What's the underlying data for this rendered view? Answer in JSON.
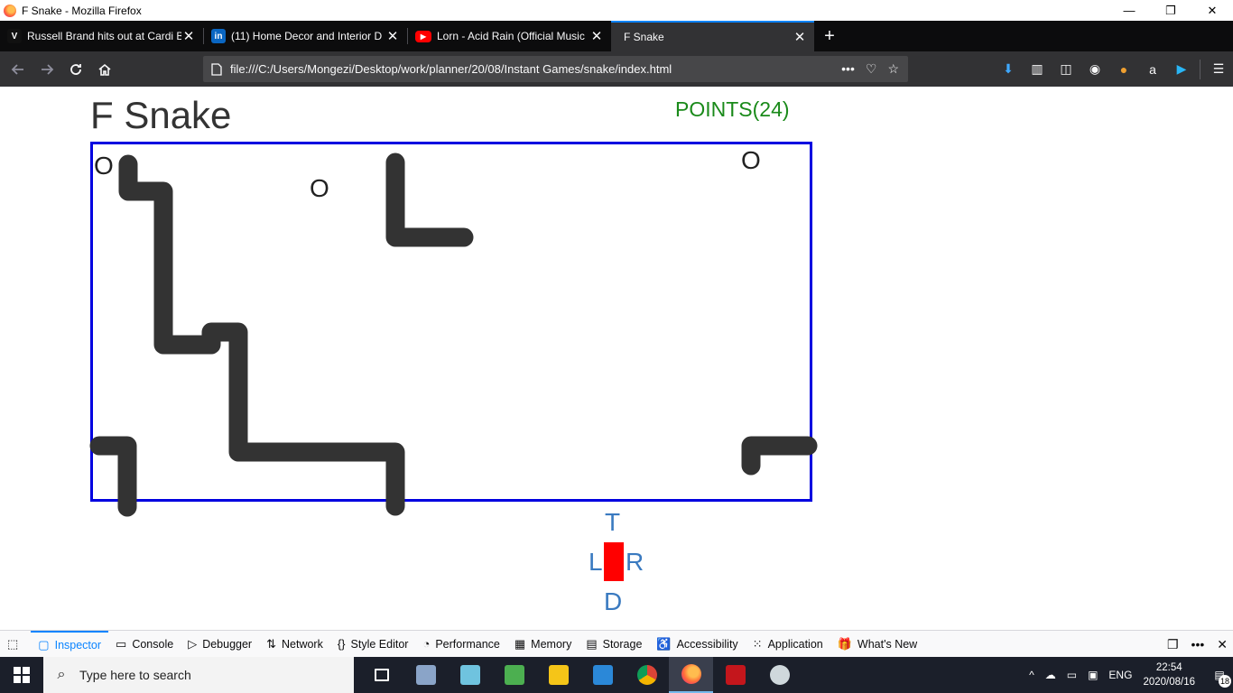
{
  "window": {
    "title": "F Snake - Mozilla Firefox",
    "controls": [
      "—",
      "❐",
      "✕"
    ]
  },
  "tabs": [
    {
      "title": "Russell Brand hits out at Cardi B",
      "favicon": "vox-icon"
    },
    {
      "title": "(11) Home Decor and Interior D",
      "favicon": "linkedin-icon"
    },
    {
      "title": "Lorn - Acid Rain (Official Music",
      "favicon": "youtube-icon"
    },
    {
      "title": "F Snake",
      "favicon": "none",
      "active": true
    }
  ],
  "navbar": {
    "url": "file:///C:/Users/Mongezi/Desktop/work/planner/20/08/Instant Games/snake/index.html"
  },
  "game": {
    "title": "F Snake",
    "points": "POINTS(24)",
    "food_char": "O",
    "controls": {
      "up": "T",
      "left": "L",
      "right": "R",
      "down": "D"
    },
    "colors": {
      "border": "#0000e0",
      "snake": "#333333",
      "points": "#1a8a1a",
      "controls": "#3a7ac0",
      "control_center": "#ff0000"
    }
  },
  "devtools": {
    "tabs": [
      "Inspector",
      "Console",
      "Debugger",
      "Network",
      "Style Editor",
      "Performance",
      "Memory",
      "Storage",
      "Accessibility",
      "Application",
      "What's New"
    ],
    "selected": "Inspector"
  },
  "taskbar": {
    "search_placeholder": "Type here to search",
    "language": "ENG",
    "time": "22:54",
    "date": "2020/08/16",
    "notification_count": "18"
  }
}
